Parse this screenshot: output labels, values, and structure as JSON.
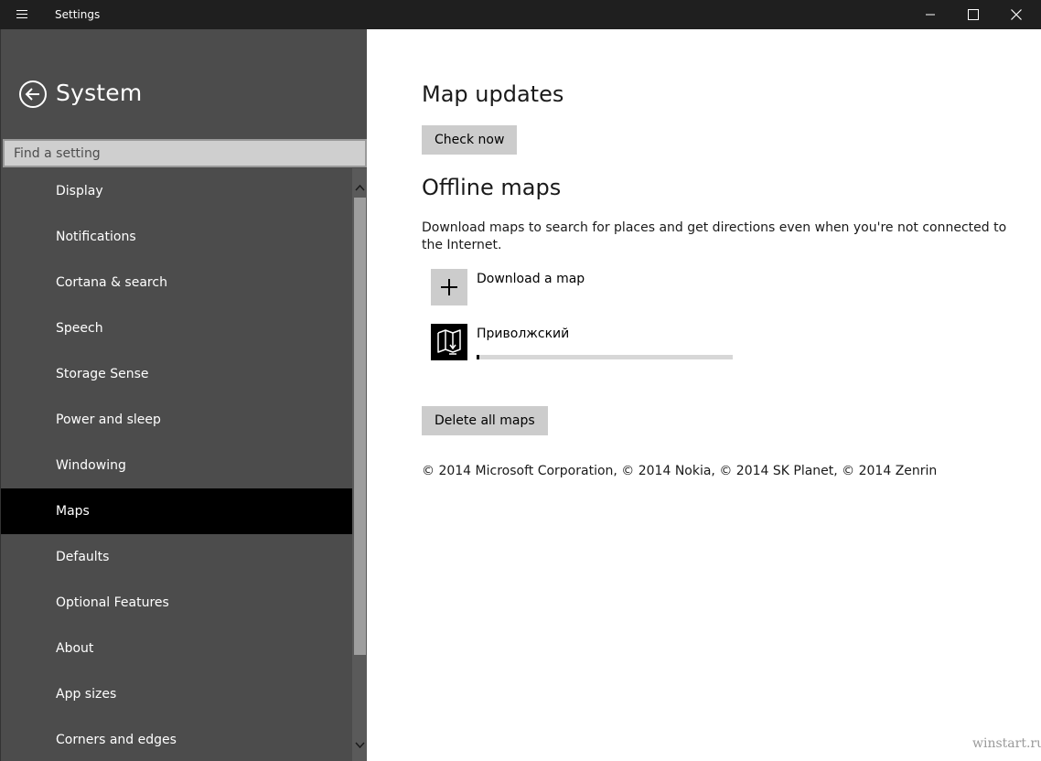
{
  "window": {
    "title": "Settings"
  },
  "sidebar": {
    "section_title": "System",
    "search_placeholder": "Find a setting",
    "items": [
      {
        "label": "Display"
      },
      {
        "label": "Notifications"
      },
      {
        "label": "Cortana & search"
      },
      {
        "label": "Speech"
      },
      {
        "label": "Storage Sense"
      },
      {
        "label": "Power and sleep"
      },
      {
        "label": "Windowing"
      },
      {
        "label": "Maps",
        "active": true
      },
      {
        "label": "Defaults"
      },
      {
        "label": "Optional Features"
      },
      {
        "label": "About"
      },
      {
        "label": "App sizes"
      },
      {
        "label": "Corners and edges"
      }
    ]
  },
  "main": {
    "map_updates_heading": "Map updates",
    "check_now_label": "Check now",
    "offline_maps_heading": "Offline maps",
    "description": "Download maps to search for places and get directions even when you're not connected to the Internet.",
    "download_map_label": "Download a map",
    "downloading_map": {
      "name": "Приволжский",
      "progress_percent": 1
    },
    "delete_all_label": "Delete all maps",
    "copyright": "© 2014 Microsoft Corporation, © 2014 Nokia, © 2014 SK Planet, © 2014 Zenrin"
  },
  "watermark": "winstart.ru",
  "icons": {
    "hamburger": "hamburger-icon",
    "minimize": "minimize-icon",
    "maximize": "maximize-icon",
    "close": "close-icon",
    "back": "back-arrow-icon",
    "add": "plus-icon",
    "map": "map-download-icon",
    "scroll_up": "chevron-up-icon",
    "scroll_down": "chevron-down-icon"
  },
  "colors": {
    "titlebar": "#1f1f1f",
    "sidebar": "#4c4c4c",
    "active_item": "#000000",
    "button": "#cccccc",
    "progress_track": "#d7d7d7"
  }
}
